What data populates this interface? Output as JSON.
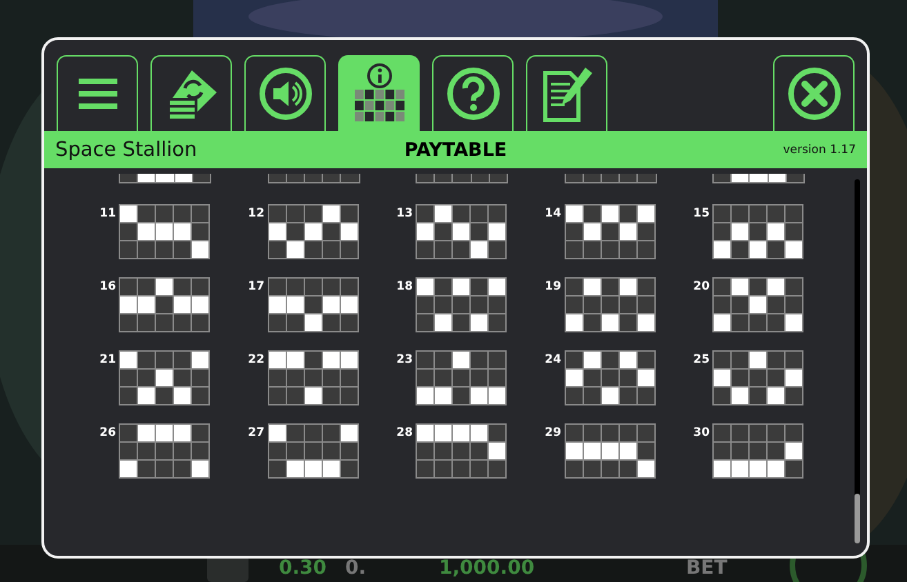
{
  "tabs": [
    {
      "selected": false
    },
    {
      "selected": false
    },
    {
      "selected": false
    },
    {
      "selected": true
    },
    {
      "selected": false
    },
    {
      "selected": false
    }
  ],
  "header": {
    "game_name": "Space Stallion",
    "title": "PAYTABLE",
    "version": "version 1.17"
  },
  "cut_rows": [
    [
      false,
      true,
      true,
      true,
      false
    ],
    [
      false,
      false,
      false,
      false,
      false
    ],
    [
      false,
      false,
      false,
      false,
      false
    ],
    [
      false,
      false,
      false,
      false,
      false
    ],
    [
      false,
      true,
      true,
      true,
      false
    ]
  ],
  "paylines": [
    {
      "number": "11",
      "rows": [
        [
          true,
          false,
          false,
          false,
          false
        ],
        [
          false,
          true,
          true,
          true,
          false
        ],
        [
          false,
          false,
          false,
          false,
          true
        ]
      ]
    },
    {
      "number": "12",
      "rows": [
        [
          false,
          false,
          false,
          true,
          false
        ],
        [
          true,
          false,
          true,
          false,
          true
        ],
        [
          false,
          true,
          false,
          false,
          false
        ]
      ]
    },
    {
      "number": "13",
      "rows": [
        [
          false,
          true,
          false,
          false,
          false
        ],
        [
          true,
          false,
          true,
          false,
          true
        ],
        [
          false,
          false,
          false,
          true,
          false
        ]
      ]
    },
    {
      "number": "14",
      "rows": [
        [
          true,
          false,
          true,
          false,
          true
        ],
        [
          false,
          true,
          false,
          true,
          false
        ],
        [
          false,
          false,
          false,
          false,
          false
        ]
      ]
    },
    {
      "number": "15",
      "rows": [
        [
          false,
          false,
          false,
          false,
          false
        ],
        [
          false,
          true,
          false,
          true,
          false
        ],
        [
          true,
          false,
          true,
          false,
          true
        ]
      ]
    },
    {
      "number": "16",
      "rows": [
        [
          false,
          false,
          true,
          false,
          false
        ],
        [
          true,
          true,
          false,
          true,
          true
        ],
        [
          false,
          false,
          false,
          false,
          false
        ]
      ]
    },
    {
      "number": "17",
      "rows": [
        [
          false,
          false,
          false,
          false,
          false
        ],
        [
          true,
          true,
          false,
          true,
          true
        ],
        [
          false,
          false,
          true,
          false,
          false
        ]
      ]
    },
    {
      "number": "18",
      "rows": [
        [
          true,
          false,
          true,
          false,
          true
        ],
        [
          false,
          false,
          false,
          false,
          false
        ],
        [
          false,
          true,
          false,
          true,
          false
        ]
      ]
    },
    {
      "number": "19",
      "rows": [
        [
          false,
          true,
          false,
          true,
          false
        ],
        [
          false,
          false,
          false,
          false,
          false
        ],
        [
          true,
          false,
          true,
          false,
          true
        ]
      ]
    },
    {
      "number": "20",
      "rows": [
        [
          false,
          true,
          false,
          true,
          false
        ],
        [
          false,
          false,
          true,
          false,
          false
        ],
        [
          true,
          false,
          false,
          false,
          true
        ]
      ]
    },
    {
      "number": "21",
      "rows": [
        [
          true,
          false,
          false,
          false,
          true
        ],
        [
          false,
          false,
          true,
          false,
          false
        ],
        [
          false,
          true,
          false,
          true,
          false
        ]
      ]
    },
    {
      "number": "22",
      "rows": [
        [
          true,
          true,
          false,
          true,
          true
        ],
        [
          false,
          false,
          false,
          false,
          false
        ],
        [
          false,
          false,
          true,
          false,
          false
        ]
      ]
    },
    {
      "number": "23",
      "rows": [
        [
          false,
          false,
          true,
          false,
          false
        ],
        [
          false,
          false,
          false,
          false,
          false
        ],
        [
          true,
          true,
          false,
          true,
          true
        ]
      ]
    },
    {
      "number": "24",
      "rows": [
        [
          false,
          true,
          false,
          true,
          false
        ],
        [
          true,
          false,
          false,
          false,
          true
        ],
        [
          false,
          false,
          true,
          false,
          false
        ]
      ]
    },
    {
      "number": "25",
      "rows": [
        [
          false,
          false,
          true,
          false,
          false
        ],
        [
          true,
          false,
          false,
          false,
          true
        ],
        [
          false,
          true,
          false,
          true,
          false
        ]
      ]
    },
    {
      "number": "26",
      "rows": [
        [
          false,
          true,
          true,
          true,
          false
        ],
        [
          false,
          false,
          false,
          false,
          false
        ],
        [
          true,
          false,
          false,
          false,
          true
        ]
      ]
    },
    {
      "number": "27",
      "rows": [
        [
          true,
          false,
          false,
          false,
          true
        ],
        [
          false,
          false,
          false,
          false,
          false
        ],
        [
          false,
          true,
          true,
          true,
          false
        ]
      ]
    },
    {
      "number": "28",
      "rows": [
        [
          true,
          true,
          true,
          true,
          false
        ],
        [
          false,
          false,
          false,
          false,
          true
        ],
        [
          false,
          false,
          false,
          false,
          false
        ]
      ]
    },
    {
      "number": "29",
      "rows": [
        [
          false,
          false,
          false,
          false,
          false
        ],
        [
          true,
          true,
          true,
          true,
          false
        ],
        [
          false,
          false,
          false,
          false,
          true
        ]
      ]
    },
    {
      "number": "30",
      "rows": [
        [
          false,
          false,
          false,
          false,
          false
        ],
        [
          false,
          false,
          false,
          false,
          true
        ],
        [
          true,
          true,
          true,
          true,
          false
        ]
      ]
    }
  ],
  "bottom_bar": {
    "bet_value": "0.30",
    "coin_value": "0.",
    "balance": "1,000.00",
    "bet_label": "BET"
  }
}
